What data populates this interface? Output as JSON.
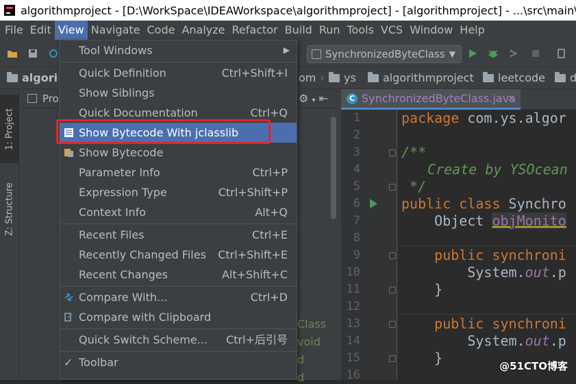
{
  "window": {
    "title": "algorithmproject - [D:\\WorkSpace\\IDEAWorkspace\\algorithmproject] - [algorithmproject] - ...\\src\\main\\java\\com\\ys\\algorithmproject\\leetcode\\demo\\SynchronizedByteClass.java - IntelliJ IDEA"
  },
  "menubar": {
    "items": [
      {
        "label": "File"
      },
      {
        "label": "Edit"
      },
      {
        "label": "View"
      },
      {
        "label": "Navigate"
      },
      {
        "label": "Code"
      },
      {
        "label": "Analyze"
      },
      {
        "label": "Refactor"
      },
      {
        "label": "Build"
      },
      {
        "label": "Run"
      },
      {
        "label": "Tools"
      },
      {
        "label": "VCS"
      },
      {
        "label": "Window"
      },
      {
        "label": "Help"
      }
    ]
  },
  "toolbar": {
    "run_config": "SynchronizedByteClass"
  },
  "navbar": {
    "crumbs": [
      {
        "label": "algori"
      },
      {
        "label": "om"
      },
      {
        "label": "ys"
      },
      {
        "label": "algorithmproject"
      },
      {
        "label": "leetcode"
      },
      {
        "label": "d"
      }
    ]
  },
  "left_strip": {
    "project_tab": "1: Project",
    "structure_tab": "Z: Structure"
  },
  "project_panel": {
    "title": "Pro",
    "peek_lines": [
      "Class",
      "void",
      "d",
      "d"
    ]
  },
  "editor": {
    "tab_name": "SynchronizedByteClass.java",
    "tab_close": "×",
    "line_numbers": [
      "1",
      "2",
      "3",
      "4",
      "5",
      "6",
      "7",
      "8",
      "9",
      "10",
      "11",
      "12",
      "13",
      "14",
      "15",
      "16"
    ],
    "code": {
      "l1_kw": "package ",
      "l1_rest": "com.ys.algor",
      "l3": "/**",
      "l4": " Create by YSOcean",
      "l5": " */",
      "l6_kw": "public class ",
      "l6_rest": "Synchro",
      "l7_type": "    Object ",
      "l7_field": "objMonito",
      "l9_kw": "    public synchroni",
      "l10_pre": "        System.",
      "l10_field": "out",
      "l10_post": ".p",
      "l11": "    }",
      "l13_kw": "    public synchroni",
      "l14_pre": "        System.",
      "l14_field": "out",
      "l14_post": ".p",
      "l15": "    }"
    }
  },
  "view_menu": {
    "items": [
      {
        "label": "Tool Windows",
        "shortcut": "",
        "submenu": true
      },
      {
        "label": "Quick Definition",
        "shortcut": "Ctrl+Shift+I"
      },
      {
        "label": "Show Siblings",
        "shortcut": ""
      },
      {
        "label": "Quick Documentation",
        "shortcut": "Ctrl+Q"
      },
      {
        "label": "Show Bytecode With jclasslib",
        "shortcut": "",
        "selected": true
      },
      {
        "label": "Show Bytecode",
        "shortcut": ""
      },
      {
        "label": "Parameter Info",
        "shortcut": "Ctrl+P"
      },
      {
        "label": "Expression Type",
        "shortcut": "Ctrl+Shift+P"
      },
      {
        "label": "Context Info",
        "shortcut": "Alt+Q"
      },
      {
        "label": "Recent Files",
        "shortcut": "Ctrl+E"
      },
      {
        "label": "Recently Changed Files",
        "shortcut": "Ctrl+Shift+E"
      },
      {
        "label": "Recent Changes",
        "shortcut": "Alt+Shift+C"
      },
      {
        "label": "Compare With...",
        "shortcut": "Ctrl+D"
      },
      {
        "label": "Compare with Clipboard",
        "shortcut": ""
      },
      {
        "label": "Quick Switch Scheme...",
        "shortcut": "Ctrl+后引号"
      },
      {
        "label": "Toolbar",
        "shortcut": "",
        "checked": true
      }
    ],
    "submenu_arrow": "▶",
    "check_mark": "✓"
  },
  "colors": {
    "selection": "#4b6eaf",
    "highlight_box": "#e3262b",
    "keyword": "#cc7832",
    "comment": "#629755"
  },
  "watermark": "@51CTO博客"
}
